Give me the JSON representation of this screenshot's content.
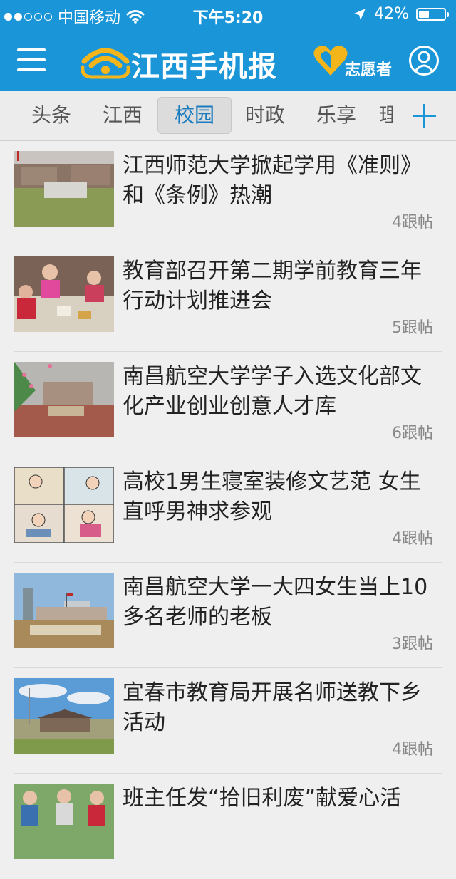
{
  "status_bar": {
    "carrier": "中国移动",
    "time": "下午5:20",
    "battery": "42%",
    "battery_level": 0.42,
    "signal_dots_filled": 2,
    "signal_dots_total": 5
  },
  "header": {
    "logo_text": "江西手机报",
    "volunteer_label": "志愿者",
    "brand_color": "#1a96d8",
    "logo_accent": "#f4b51a"
  },
  "tabs": [
    {
      "label": "头条",
      "active": false
    },
    {
      "label": "江西",
      "active": false
    },
    {
      "label": "校园",
      "active": true
    },
    {
      "label": "时政",
      "active": false
    },
    {
      "label": "乐享",
      "active": false
    },
    {
      "label": "理",
      "active": false
    }
  ],
  "articles": [
    {
      "title": "江西师范大学掀起学用《准则》和《条例》热潮",
      "count": "4跟帖"
    },
    {
      "title": "教育部召开第二期学前教育三年行动计划推进会",
      "count": "5跟帖"
    },
    {
      "title": "南昌航空大学学子入选文化部文化产业创业创意人才库",
      "count": "6跟帖"
    },
    {
      "title": "高校1男生寝室装修文艺范 女生直呼男神求参观",
      "count": "4跟帖"
    },
    {
      "title": "南昌航空大学一大四女生当上10多名老师的老板",
      "count": "3跟帖"
    },
    {
      "title": "宜春市教育局开展名师送教下乡活动",
      "count": "4跟帖"
    },
    {
      "title": "班主任发“拾旧利废”献爱心活",
      "count": ""
    }
  ]
}
